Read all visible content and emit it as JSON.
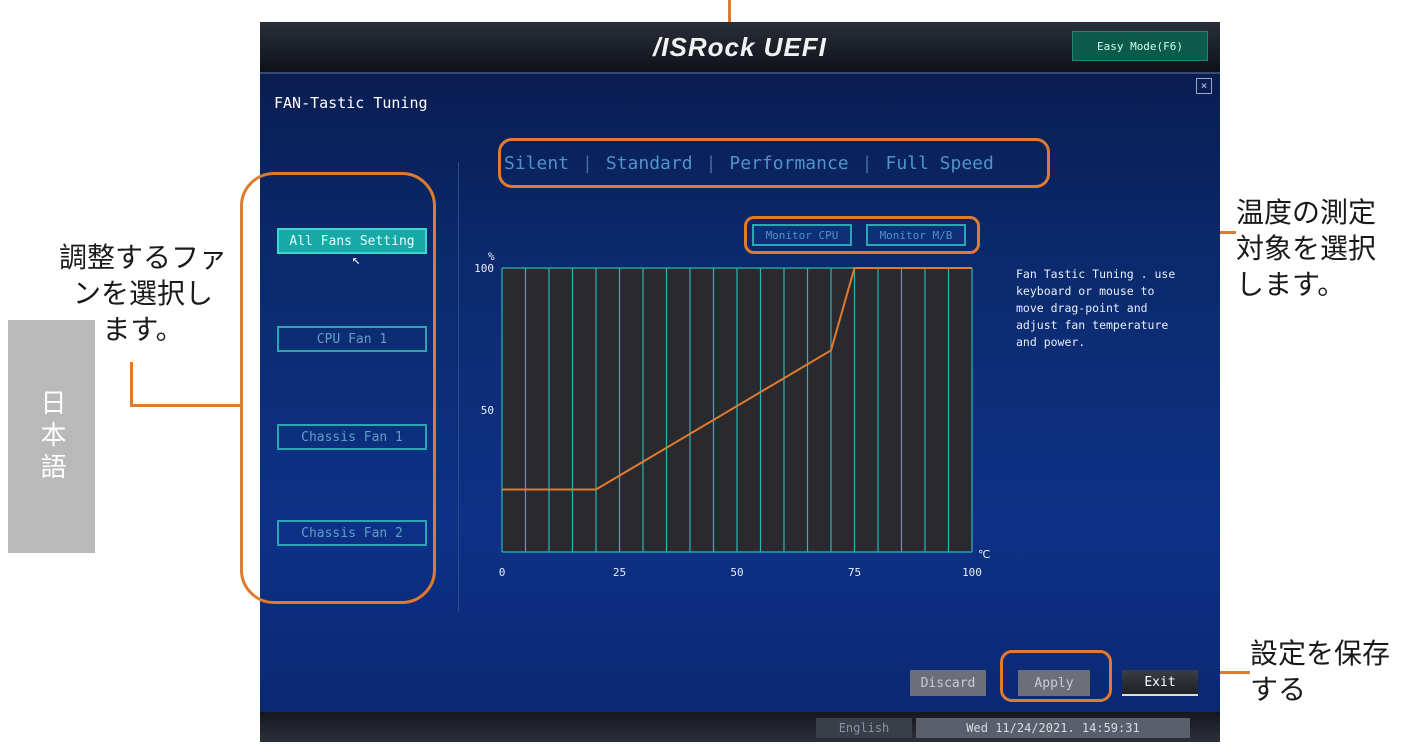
{
  "annotations": {
    "fan_select": "調整するファンを選択します。",
    "fan_select_lines": [
      "調整するファ",
      "ンを選択し",
      "ます。"
    ],
    "monitor_select_lines": [
      "温度の測定",
      "対象を選択",
      "します。"
    ],
    "save_lines": [
      "設定を保存",
      "する"
    ],
    "language_tab": "日本語"
  },
  "bios": {
    "logo": "/ISRock UEFI",
    "easy_mode_label": "Easy Mode(F6)",
    "close_label": "×",
    "page_title": "FAN-Tastic Tuning",
    "fans": [
      "All Fans Setting",
      "CPU Fan 1",
      "Chassis Fan 1",
      "Chassis Fan 2"
    ],
    "active_fan_index": 0,
    "modes": [
      "Silent",
      "Standard",
      "Performance",
      "Full Speed"
    ],
    "monitor_buttons": [
      "Monitor CPU",
      "Monitor M/B"
    ],
    "help_text": "Fan Tastic Tuning . use\nkeyboard or mouse to\nmove drag-point and\nadjust fan temperature\nand power.",
    "buttons": {
      "discard": "Discard",
      "apply": "Apply",
      "exit": "Exit"
    },
    "status": {
      "language": "English",
      "datetime": "Wed 11/24/2021. 14:59:31"
    }
  },
  "colors": {
    "accent_orange": "#e07a2e",
    "grid_teal": "#2ab4b8",
    "curve": "#e07a2e",
    "plot_bg": "#2a2a2e"
  },
  "chart_data": {
    "type": "line",
    "ylabel": "%",
    "xlabel": "℃",
    "xlim": [
      0,
      100
    ],
    "ylim": [
      0,
      100
    ],
    "x_ticks": [
      0,
      25,
      50,
      75,
      100
    ],
    "y_ticks": [
      100,
      50
    ],
    "grid": true,
    "series": [
      {
        "x": [
          0,
          20,
          70,
          75,
          100
        ],
        "y": [
          22,
          22,
          71,
          100,
          100
        ]
      }
    ]
  }
}
